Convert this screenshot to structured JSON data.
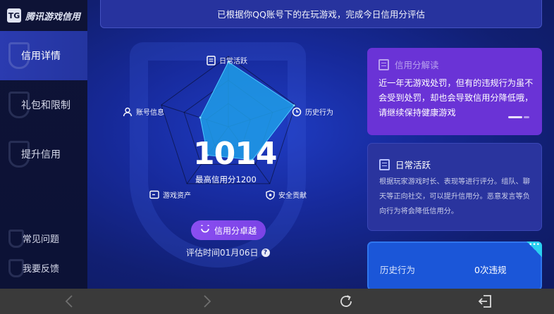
{
  "app": {
    "logo_text": "腾讯游戏信用",
    "logo_mark": "TG"
  },
  "sidebar": {
    "items": [
      {
        "label": "信用详情",
        "active": true
      },
      {
        "label": "礼包和限制",
        "active": false
      },
      {
        "label": "提升信用",
        "active": false
      }
    ],
    "bottom_items": [
      {
        "label": "常见问题"
      },
      {
        "label": "我要反馈"
      }
    ]
  },
  "banner": {
    "text": "已根据你QQ账号下的在玩游戏，完成今日信用分评估"
  },
  "radar": {
    "dimensions": [
      {
        "label": "日常活跃",
        "icon": "document-icon"
      },
      {
        "label": "历史行为",
        "icon": "clock-icon"
      },
      {
        "label": "安全贡献",
        "icon": "shield-icon"
      },
      {
        "label": "游戏资产",
        "icon": "wallet-icon"
      },
      {
        "label": "账号信息",
        "icon": "user-icon"
      }
    ],
    "values": [
      0.92,
      0.98,
      0.58,
      0.5,
      0.42
    ],
    "fill_color": "#1e9ee8"
  },
  "score": {
    "value": "1014",
    "subtitle": "最高信用分1200"
  },
  "tier_button": {
    "label": "信用分卓越",
    "icon": "smile-icon"
  },
  "eval_time": {
    "text": "评估时间01月06日",
    "help": "?"
  },
  "cards": {
    "interpret": {
      "title": "信用分解读",
      "body": "近一年无游戏处罚，但有的违规行为虽不会受到处罚，却也会导致信用分降低哦，请继续保持健康游戏"
    },
    "daily": {
      "title": "日常活跃",
      "body": "根据玩家游戏时长、表现等进行评分。组队、聊天等正向社交，可以提升信用分。恶意发言等负向行为将会降低信用分。"
    },
    "history": {
      "label": "历史行为",
      "value": "0次违规",
      "corner": "•••"
    }
  },
  "colors": {
    "accent_purple": "#6a33d6",
    "card_blue": "#1b56d8",
    "nav_active": "#2b3bb0"
  }
}
